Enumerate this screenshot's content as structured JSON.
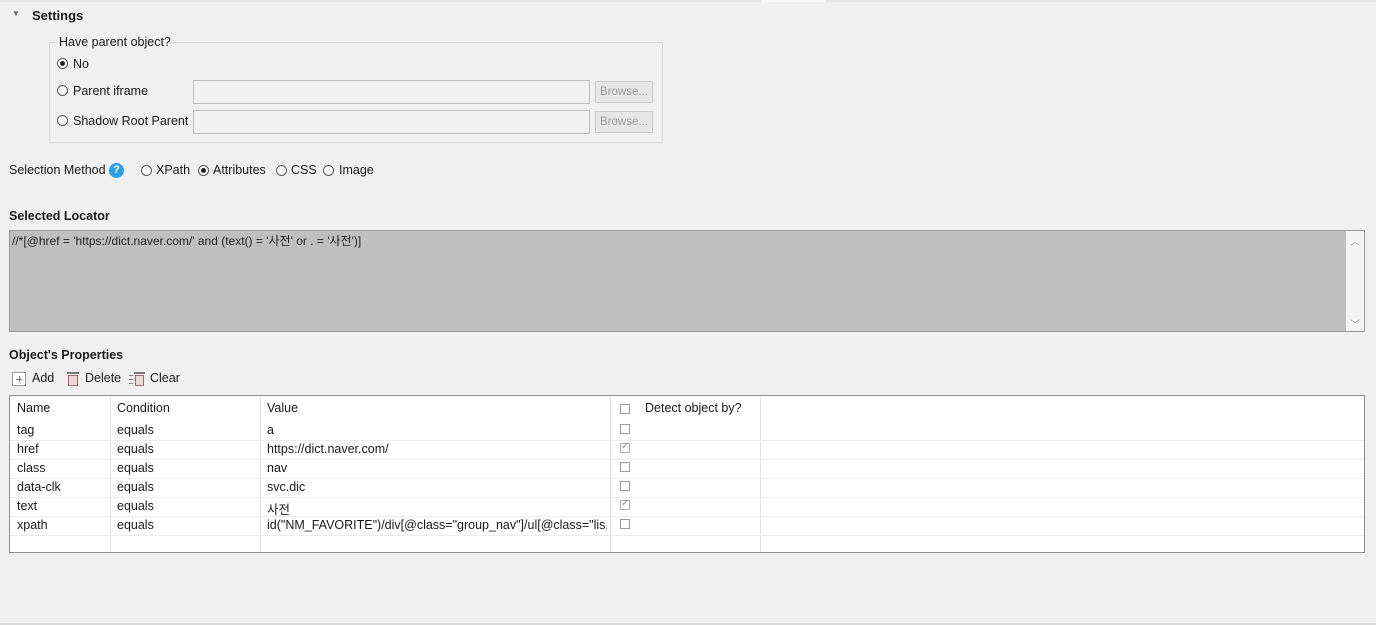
{
  "settings": {
    "title": "Settings",
    "parent": {
      "legend": "Have parent object?",
      "options": [
        {
          "label": "No",
          "checked": true
        },
        {
          "label": "Parent iframe",
          "checked": false,
          "value": "",
          "browse": "Browse..."
        },
        {
          "label": "Shadow Root Parent",
          "checked": false,
          "value": "",
          "browse": "Browse..."
        }
      ]
    }
  },
  "selection_method": {
    "label": "Selection Method",
    "help_icon": "?",
    "options": [
      {
        "label": "XPath",
        "checked": false
      },
      {
        "label": "Attributes",
        "checked": true
      },
      {
        "label": "CSS",
        "checked": false
      },
      {
        "label": "Image",
        "checked": false
      }
    ]
  },
  "locator": {
    "title": "Selected Locator",
    "value": "//*[@href = 'https://dict.naver.com/' and (text() = '사전' or . = '사전')]"
  },
  "properties": {
    "title": "Object's Properties",
    "toolbar": {
      "add": "Add",
      "delete": "Delete",
      "clear": "Clear"
    },
    "columns": {
      "name": "Name",
      "condition": "Condition",
      "value": "Value",
      "detect": "Detect object by?"
    },
    "rows": [
      {
        "name": "tag",
        "condition": "equals",
        "value": "a",
        "detect": false
      },
      {
        "name": "href",
        "condition": "equals",
        "value": "https://dict.naver.com/",
        "detect": true
      },
      {
        "name": "class",
        "condition": "equals",
        "value": "nav",
        "detect": false
      },
      {
        "name": "data-clk",
        "condition": "equals",
        "value": "svc.dic",
        "detect": false
      },
      {
        "name": "text",
        "condition": "equals",
        "value": "사전",
        "detect": true
      },
      {
        "name": "xpath",
        "condition": "equals",
        "value": "id(\"NM_FAVORITE\")/div[@class=\"group_nav\"]/ul[@class=\"lis...",
        "detect": false
      }
    ]
  }
}
